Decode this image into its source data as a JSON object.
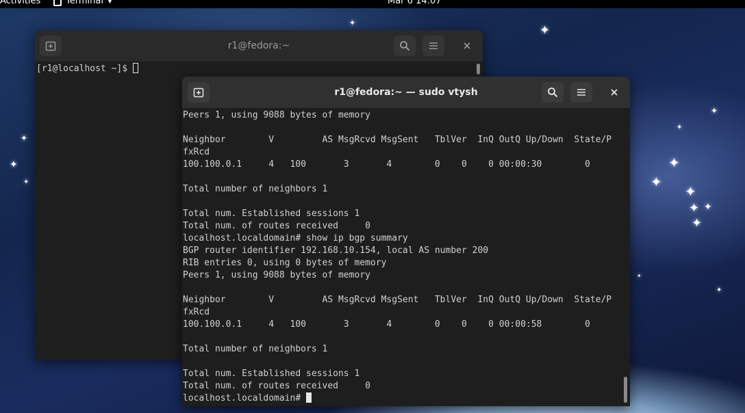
{
  "topbar": {
    "activities": "Activities",
    "app_name": "Terminal",
    "clock": "Mar 6  14:07"
  },
  "back_window": {
    "title": "r1@fedora:~",
    "lines": [
      "[r1@localhost ~]$ "
    ]
  },
  "front_window": {
    "title": "r1@fedora:~ — sudo vtysh",
    "lines": [
      "Peers 1, using 9088 bytes of memory",
      "",
      "Neighbor        V         AS MsgRcvd MsgSent   TblVer  InQ OutQ Up/Down  State/P",
      "fxRcd",
      "100.100.0.1     4   100       3       4        0    0    0 00:00:30        0",
      "",
      "Total number of neighbors 1",
      "",
      "Total num. Established sessions 1",
      "Total num. of routes received     0",
      "localhost.localdomain# show ip bgp summary",
      "BGP router identifier 192.168.10.154, local AS number 200",
      "RIB entries 0, using 0 bytes of memory",
      "Peers 1, using 9088 bytes of memory",
      "",
      "Neighbor        V         AS MsgRcvd MsgSent   TblVer  InQ OutQ Up/Down  State/P",
      "fxRcd",
      "100.100.0.1     4   100       3       4        0    0    0 00:00:58        0",
      "",
      "Total number of neighbors 1",
      "",
      "Total num. Established sessions 1",
      "Total num. of routes received     0"
    ],
    "prompt": "localhost.localdomain# "
  },
  "icons": {
    "new_tab": "new-tab-icon",
    "search": "search-icon",
    "menu": "hamburger-menu-icon",
    "close": "close-icon"
  }
}
